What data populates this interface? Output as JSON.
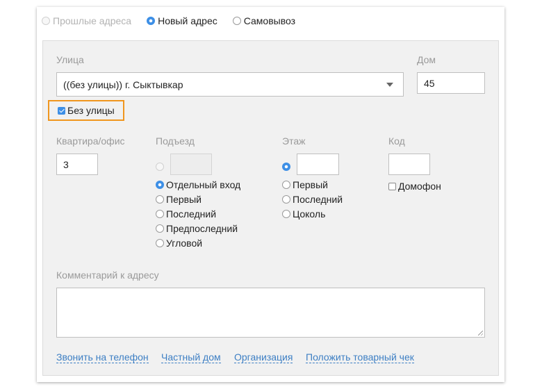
{
  "address_mode": {
    "past_label": "Прошлые адреса",
    "new_label": "Новый адрес",
    "pickup_label": "Самовывоз",
    "selected": "Новый адрес"
  },
  "street": {
    "label": "Улица",
    "value": "((без улицы)) г. Сыктывкар"
  },
  "house": {
    "label": "Дом",
    "value": "45"
  },
  "no_street": {
    "label": "Без улицы",
    "checked": true,
    "highlight_color": "#f0961e"
  },
  "apartment": {
    "label": "Квартира/офис",
    "value": "3"
  },
  "entrance": {
    "label": "Подъезд",
    "custom_value": "",
    "options": [
      "Отдельный вход",
      "Первый",
      "Последний",
      "Предпоследний",
      "Угловой"
    ],
    "selected": "Отдельный вход"
  },
  "floor": {
    "label": "Этаж",
    "custom_value": "",
    "options": [
      "Первый",
      "Последний",
      "Цоколь"
    ],
    "selected": "custom"
  },
  "code": {
    "label": "Код",
    "value": "",
    "intercom_label": "Домофон",
    "intercom_checked": false
  },
  "comment": {
    "label": "Комментарий к адресу",
    "value": ""
  },
  "links": [
    "Звонить на телефон",
    "Частный дом",
    "Организация",
    "Положить товарный чек"
  ],
  "colors": {
    "accent": "#3d8fe6",
    "link": "#3d7fc4",
    "panel_bg": "#f1f1f1",
    "label_gray": "#9a9a9a"
  }
}
